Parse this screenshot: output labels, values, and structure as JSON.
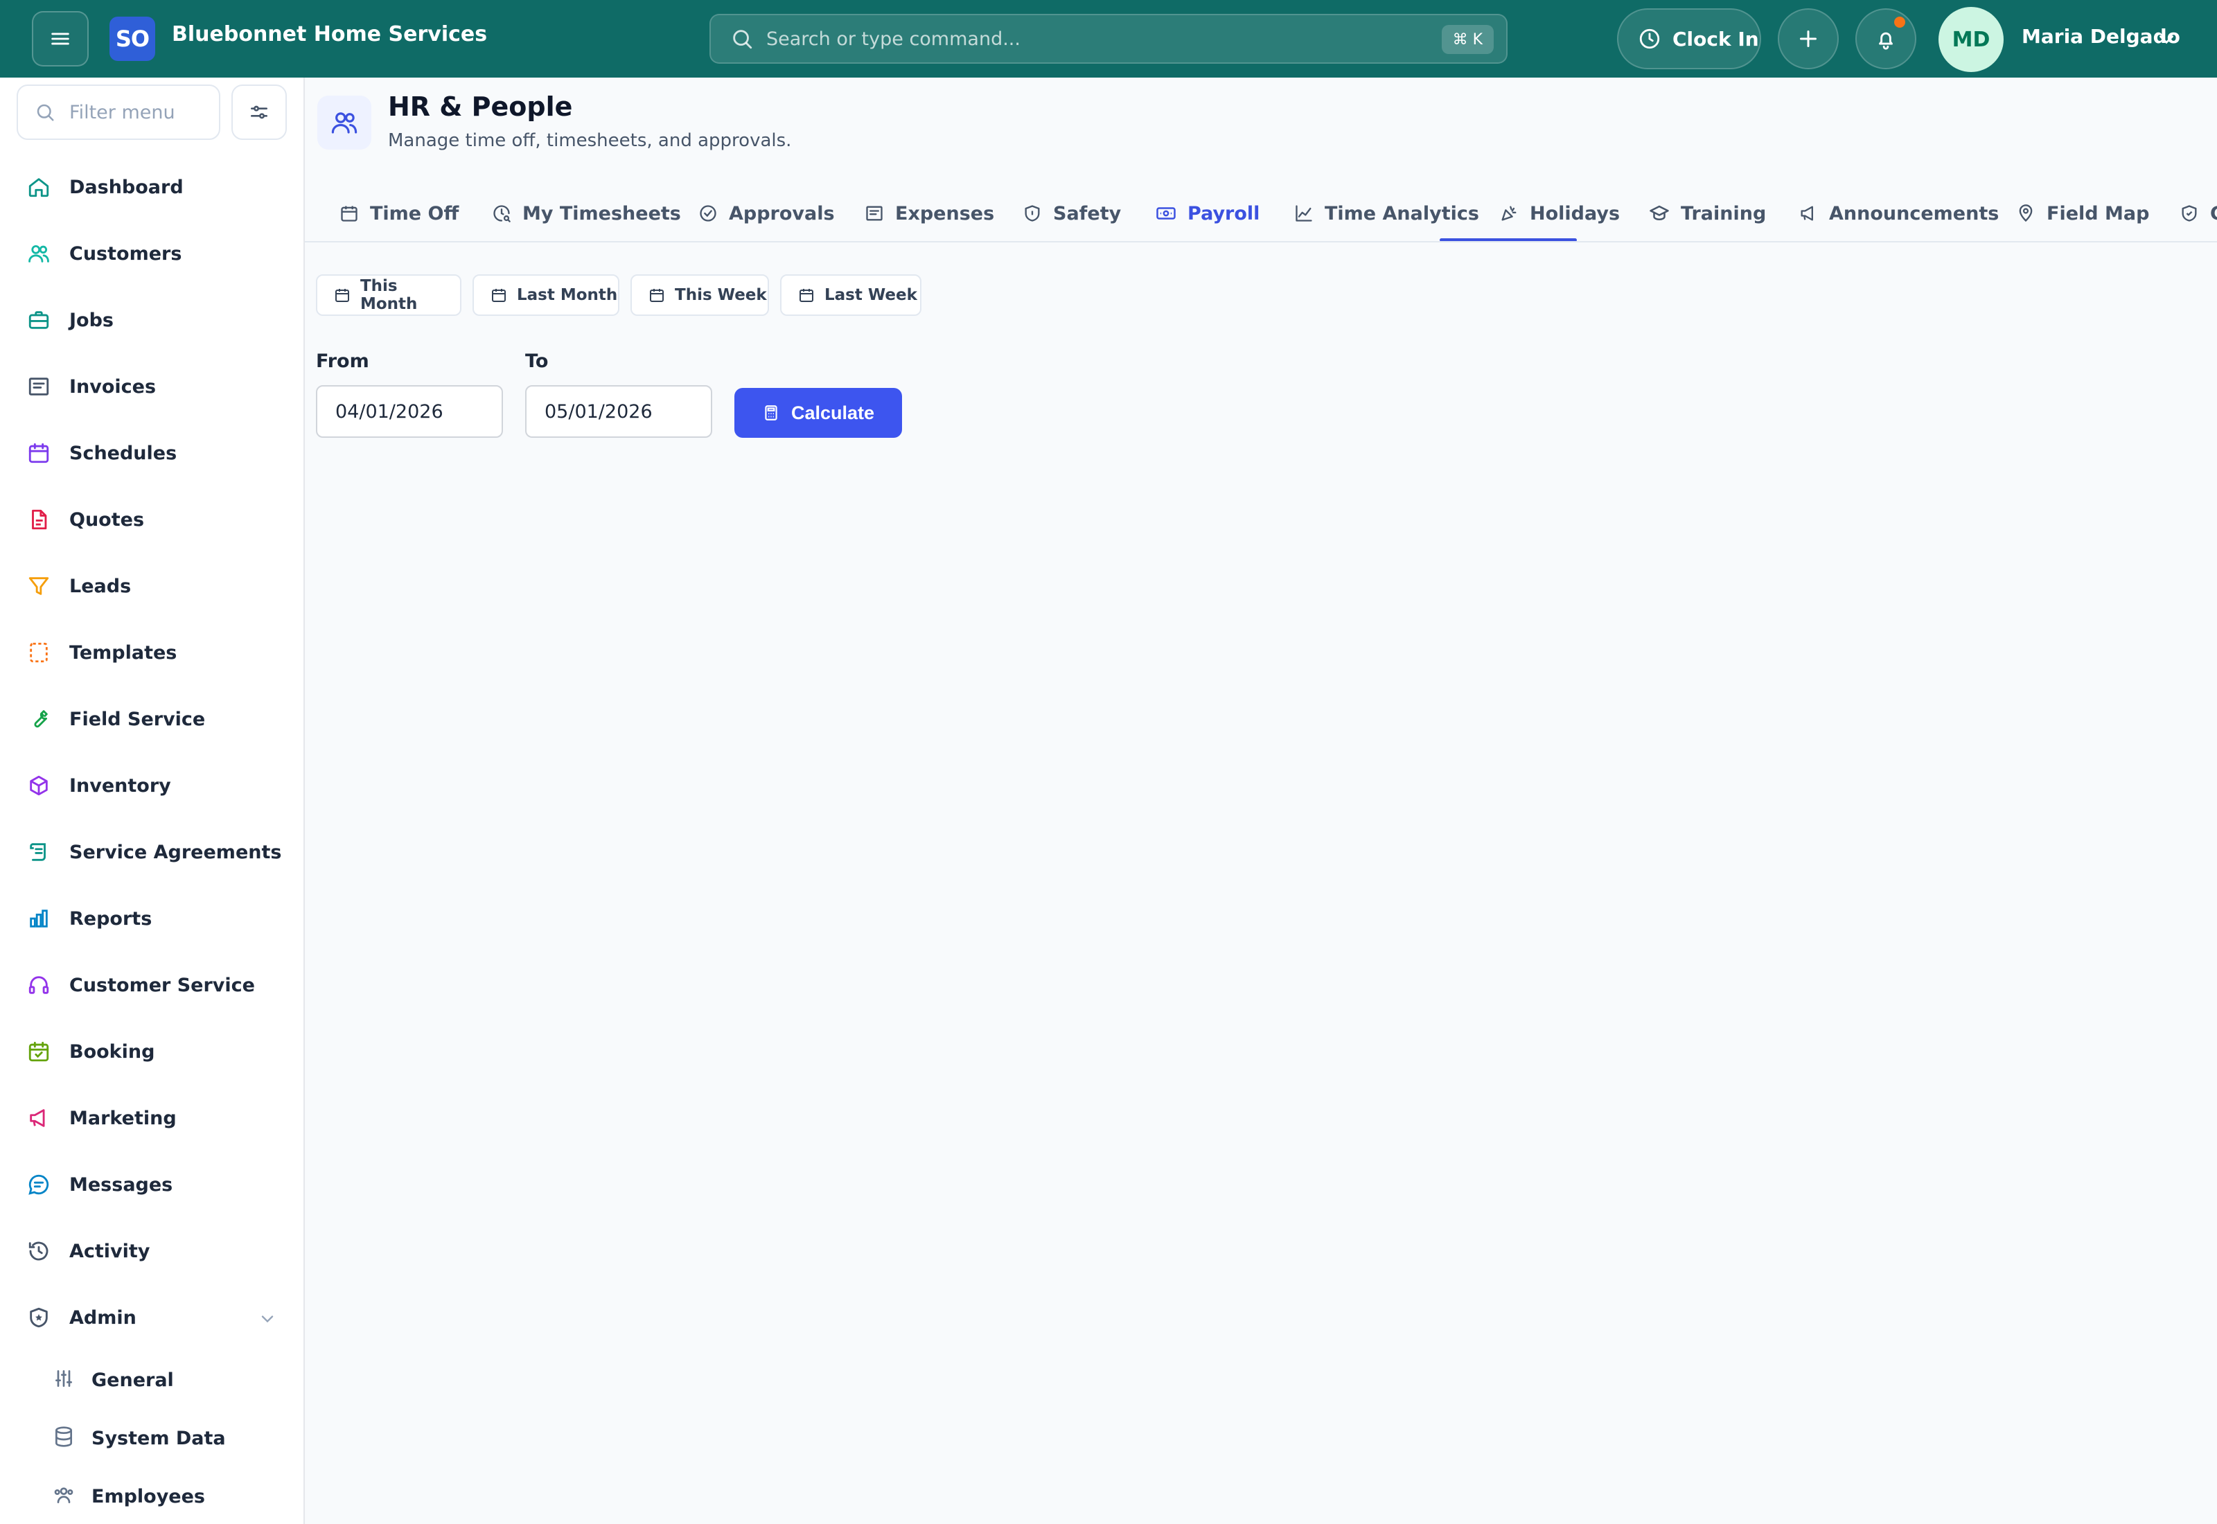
{
  "app": {
    "logo_text": "SO",
    "brand": "Bluebonnet Home Services"
  },
  "topbar": {
    "search_placeholder": "Search or type command...",
    "search_shortcut": "⌘ K",
    "clock_in_label": "Clock In",
    "user_initials": "MD",
    "user_name": "Maria Delgado"
  },
  "sidebar": {
    "filter_placeholder": "Filter menu",
    "items": [
      {
        "label": "Dashboard",
        "icon": "home-icon",
        "color": "#0d9488"
      },
      {
        "label": "Customers",
        "icon": "users-icon",
        "color": "#14b8a6"
      },
      {
        "label": "Jobs",
        "icon": "briefcase-icon",
        "color": "#0d9488"
      },
      {
        "label": "Invoices",
        "icon": "receipt-icon",
        "color": "#475569"
      },
      {
        "label": "Schedules",
        "icon": "calendar-icon",
        "color": "#7c3aed"
      },
      {
        "label": "Quotes",
        "icon": "file-icon",
        "color": "#e11d48"
      },
      {
        "label": "Leads",
        "icon": "funnel-icon",
        "color": "#f59e0b"
      },
      {
        "label": "Templates",
        "icon": "template-icon",
        "color": "#f97316"
      },
      {
        "label": "Field Service",
        "icon": "wrench-icon",
        "color": "#16a34a"
      },
      {
        "label": "Inventory",
        "icon": "box-icon",
        "color": "#9333ea"
      },
      {
        "label": "Service Agreements",
        "icon": "scroll-icon",
        "color": "#0d9488"
      },
      {
        "label": "Reports",
        "icon": "bar-chart-icon",
        "color": "#0284c7"
      },
      {
        "label": "Customer Service",
        "icon": "headset-icon",
        "color": "#9333ea"
      },
      {
        "label": "Booking",
        "icon": "calendar-check-icon",
        "color": "#65a30d"
      },
      {
        "label": "Marketing",
        "icon": "megaphone-icon",
        "color": "#db2777"
      },
      {
        "label": "Messages",
        "icon": "chat-icon",
        "color": "#0284c7"
      },
      {
        "label": "Activity",
        "icon": "history-icon",
        "color": "#475569"
      },
      {
        "label": "Admin",
        "icon": "shield-star-icon",
        "color": "#475569"
      }
    ],
    "admin_sub": [
      {
        "label": "General",
        "icon": "sliders-icon"
      },
      {
        "label": "System Data",
        "icon": "database-icon"
      },
      {
        "label": "Employees",
        "icon": "people-icon"
      }
    ]
  },
  "page": {
    "title": "HR & People",
    "subtitle": "Manage time off, timesheets, and approvals."
  },
  "tabs": [
    {
      "label": "Time Off",
      "icon": "calendar-icon"
    },
    {
      "label": "My Timesheets",
      "icon": "clock-search-icon"
    },
    {
      "label": "Approvals",
      "icon": "check-circle-icon"
    },
    {
      "label": "Expenses",
      "icon": "receipt-icon"
    },
    {
      "label": "Safety",
      "icon": "shield-icon"
    },
    {
      "label": "Payroll",
      "icon": "banknote-icon",
      "active": true
    },
    {
      "label": "Time Analytics",
      "icon": "line-chart-icon"
    },
    {
      "label": "Holidays",
      "icon": "party-icon"
    },
    {
      "label": "Training",
      "icon": "graduation-cap-icon"
    },
    {
      "label": "Announcements",
      "icon": "megaphone-icon"
    },
    {
      "label": "Field Map",
      "icon": "map-pin-icon"
    },
    {
      "label": "C",
      "icon": "shield-check-icon"
    }
  ],
  "payroll": {
    "presets": [
      "This Month",
      "Last Month",
      "This Week",
      "Last Week"
    ],
    "from_label": "From",
    "to_label": "To",
    "from_value": "04/01/2026",
    "to_value": "05/01/2026",
    "calculate_label": "Calculate"
  },
  "colors": {
    "topbar": "#0f6b66",
    "accent": "#3d55ef",
    "notification_dot": "#f97316"
  }
}
